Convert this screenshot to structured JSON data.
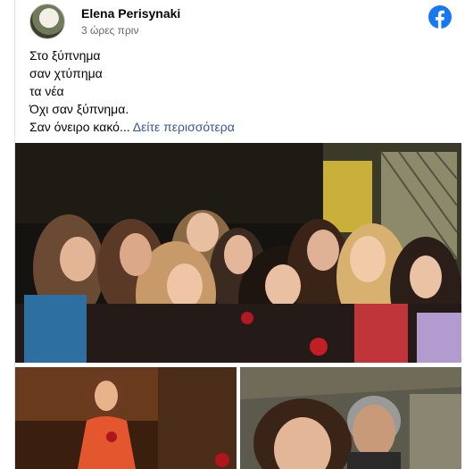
{
  "post": {
    "author": "Elena Perisynaki",
    "timestamp": "3 ώρες πριν",
    "lines": [
      "Στο ξύπνημα",
      "σαν χτύπημα",
      "τα νέα",
      "Όχι σαν ξύπνημα.",
      "Σαν όνειρο κακό..."
    ],
    "see_more": "Δείτε περισσότερα"
  },
  "icons": {
    "avatar": "profile-photo",
    "brand": "facebook-icon"
  },
  "colors": {
    "facebook_blue": "#1877f2",
    "link": "#385898",
    "secondary_text": "#65676b"
  }
}
